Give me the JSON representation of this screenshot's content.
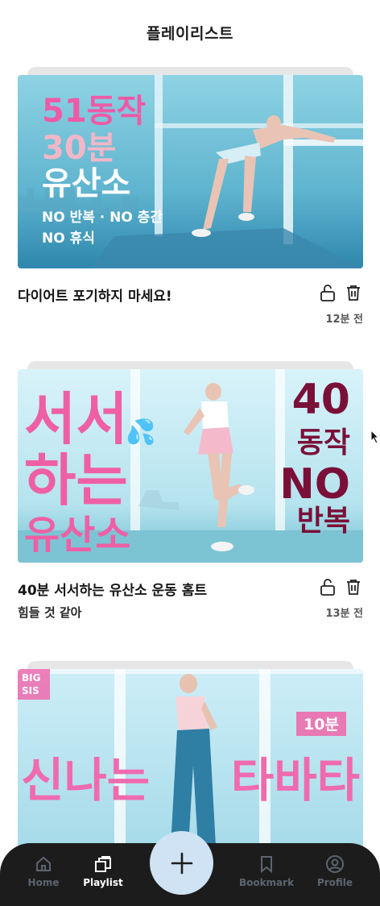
{
  "header": {
    "title": "플레이리스트"
  },
  "playlist": [
    {
      "title": "다이어트 포기하지 마세요!",
      "subtitle": "",
      "time": "12분 전",
      "thumbnail": {
        "line1": "51동작",
        "line2": "30분",
        "line3": "유산소",
        "line4": "NO 반복 · NO 층간",
        "line5": "NO 휴식",
        "colors": {
          "line1": "#ee5aa6",
          "line2": "#f2b7c6",
          "line3": "#ffffff",
          "bg_top": "#7ec8dc",
          "bg_bottom": "#2f8fb3"
        }
      }
    },
    {
      "title": "40분 서서하는 유산소 운동 홈트",
      "subtitle": "힘들 것 같아",
      "time": "13분 전",
      "thumbnail": {
        "left_line1": "서서",
        "left_line2": "하는",
        "left_line3": "유산소",
        "right_line1": "40",
        "right_line2": "동작",
        "right_line3": "NO",
        "right_line4": "반복",
        "colors": {
          "left": "#ef5fa5",
          "right": "#7a1038",
          "bg_top": "#d4f0f8",
          "bg_bottom": "#7fc8d8"
        }
      }
    },
    {
      "title": "",
      "subtitle": "",
      "time": "",
      "thumbnail": {
        "badge": "BIG SIS",
        "badge_line1": "BIG",
        "badge_line2": "SIS",
        "tag": "10분",
        "left_text": "신나는",
        "right_text": "타바타",
        "colors": {
          "text": "#ef6aae",
          "tag_bg": "#e879b5",
          "bg_top": "#c7ebf5",
          "bg_bottom": "#a8dcea"
        }
      }
    }
  ],
  "tabbar": {
    "tabs": [
      {
        "label": "Home",
        "icon": "home-icon",
        "active": false
      },
      {
        "label": "Playlist",
        "icon": "playlist-icon",
        "active": true
      },
      {
        "label": "Bookmark",
        "icon": "bookmark-icon",
        "active": false
      },
      {
        "label": "Profile",
        "icon": "profile-icon",
        "active": false
      }
    ],
    "fab_icon": "plus-icon",
    "colors": {
      "bar": "#1c1c1c",
      "fab": "#cfe3f5",
      "active": "#ffffff",
      "inactive": "#5e6470"
    }
  }
}
